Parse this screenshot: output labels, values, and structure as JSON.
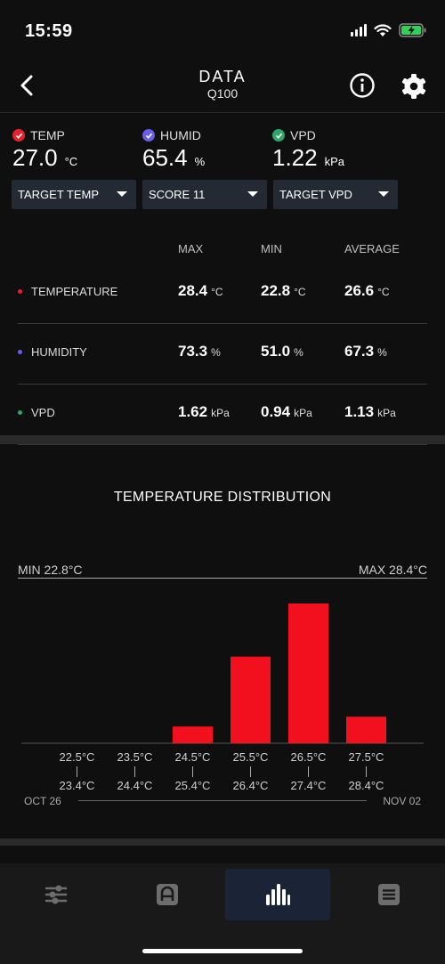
{
  "status": {
    "time": "15:59"
  },
  "nav": {
    "title": "DATA",
    "subtitle": "Q100"
  },
  "readings": [
    {
      "label": "TEMP",
      "value": "27.0",
      "unit": "°C",
      "color": "#e8202e"
    },
    {
      "label": "HUMID",
      "value": "65.4",
      "unit": "%",
      "color": "#6a5de8"
    },
    {
      "label": "VPD",
      "value": "1.22",
      "unit": "kPa",
      "color": "#2fa66a"
    }
  ],
  "dropdowns": [
    "TARGET TEMP",
    "SCORE 11",
    "TARGET VPD"
  ],
  "stats": {
    "headers": {
      "max": "MAX",
      "min": "MIN",
      "avg": "AVERAGE"
    },
    "rows": [
      {
        "name": "TEMPERATURE",
        "color": "#e8202e",
        "max": "28.4",
        "min": "22.8",
        "avg": "26.6",
        "unit": "°C"
      },
      {
        "name": "HUMIDITY",
        "color": "#6a5de8",
        "max": "73.3",
        "min": "51.0",
        "avg": "67.3",
        "unit": "%"
      },
      {
        "name": "VPD",
        "color": "#2fa66a",
        "max": "1.62",
        "min": "0.94",
        "avg": "1.13",
        "unit": "kPa"
      }
    ]
  },
  "chart": {
    "title": "TEMPERATURE DISTRIBUTION",
    "min_label": "MIN 22.8°C",
    "max_label": "MAX 28.4°C",
    "date_start": "OCT 26",
    "date_end": "NOV 02"
  },
  "chart_data": {
    "type": "bar",
    "title": "TEMPERATURE DISTRIBUTION",
    "categories": [
      "22.5°C-23.4°C",
      "23.5°C-24.4°C",
      "24.5°C-25.4°C",
      "25.5°C-26.4°C",
      "26.5°C-27.4°C",
      "27.5°C-28.4°C"
    ],
    "bin_low": [
      "22.5°C",
      "23.5°C",
      "24.5°C",
      "25.5°C",
      "26.5°C",
      "27.5°C"
    ],
    "bin_high": [
      "23.4°C",
      "24.4°C",
      "25.4°C",
      "26.4°C",
      "27.4°C",
      "28.4°C"
    ],
    "values": [
      0,
      0,
      12,
      62,
      100,
      19
    ],
    "ylim": [
      0,
      100
    ],
    "bar_color": "#f2101e",
    "grid": false
  },
  "tabs": [
    {
      "icon": "sliders-icon",
      "active": false
    },
    {
      "icon": "dashboard-icon",
      "active": false
    },
    {
      "icon": "bar-chart-icon",
      "active": true
    },
    {
      "icon": "list-icon",
      "active": false
    }
  ]
}
